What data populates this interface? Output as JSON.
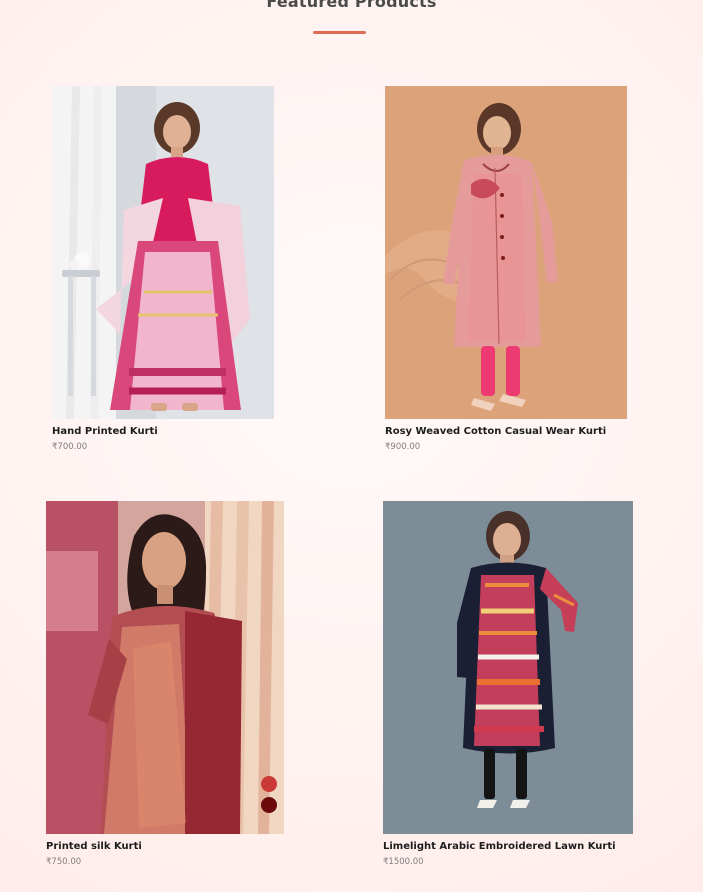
{
  "section": {
    "title": "Featured Products"
  },
  "products": [
    {
      "name": "Hand Printed Kurti",
      "price": "₹700.00"
    },
    {
      "name": "Rosy Weaved Cotton Casual Wear Kurti",
      "price": "₹900.00"
    },
    {
      "name": "Printed silk Kurti",
      "price": "₹750.00"
    },
    {
      "name": "Limelight Arabic Embroidered Lawn Kurti",
      "price": "₹1500.00"
    }
  ],
  "colors": {
    "accent": "#e06b54",
    "swatch_1": "#c93a36",
    "swatch_2": "#6a0a0a"
  }
}
